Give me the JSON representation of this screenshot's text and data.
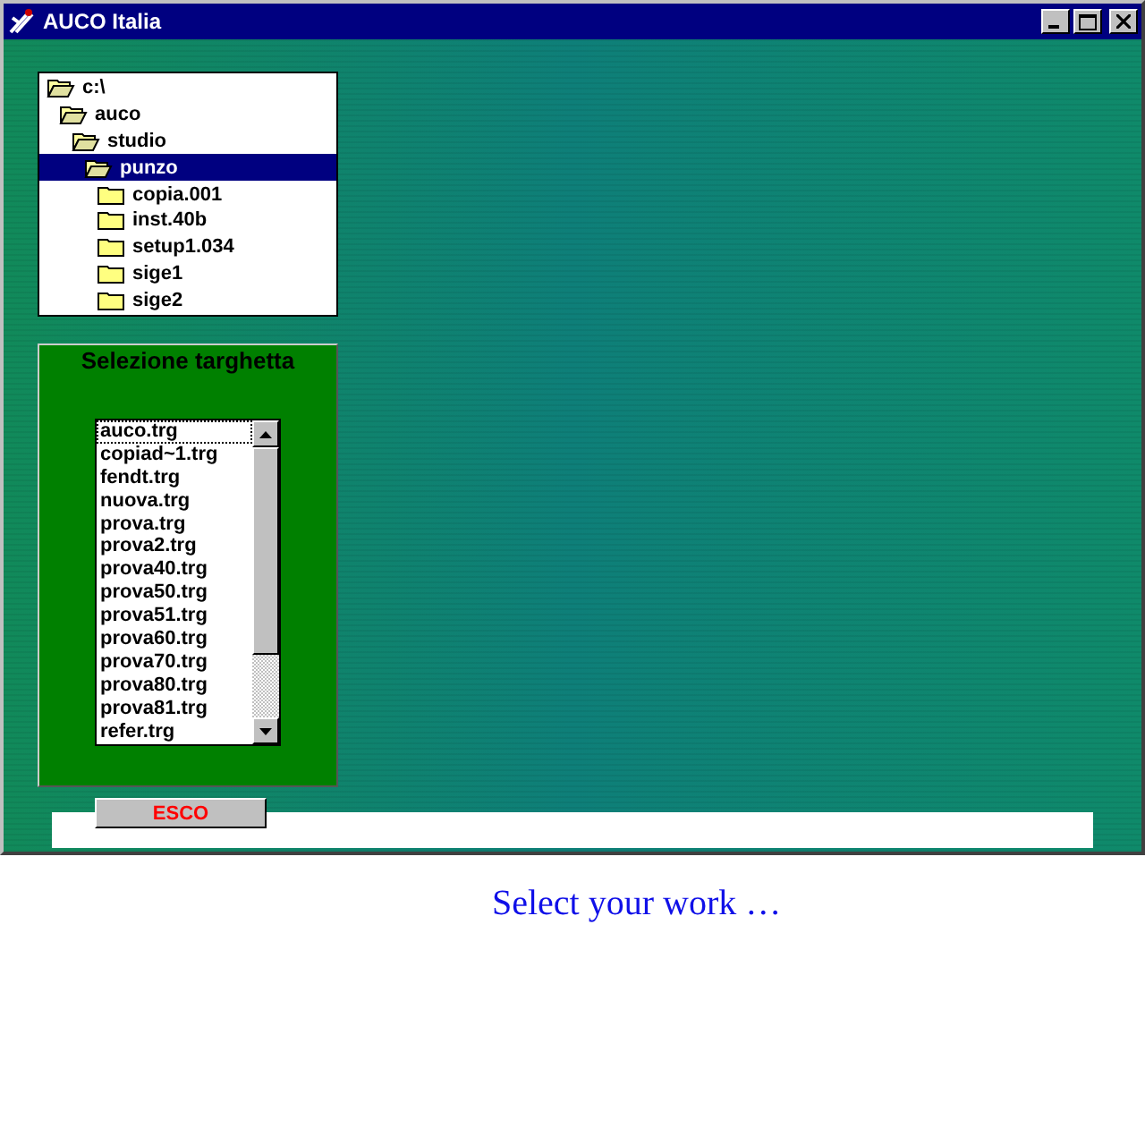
{
  "window": {
    "title": "AUCO Italia"
  },
  "folder_tree": [
    {
      "label": "c:\\",
      "expanded": true,
      "selected": false,
      "children": [
        {
          "label": "auco",
          "expanded": true,
          "selected": false,
          "children": [
            {
              "label": "studio",
              "expanded": true,
              "selected": false,
              "children": [
                {
                  "label": "punzo",
                  "expanded": true,
                  "selected": true,
                  "children": [
                    {
                      "label": "copia.001",
                      "expanded": false,
                      "selected": false
                    },
                    {
                      "label": "inst.40b",
                      "expanded": false,
                      "selected": false
                    },
                    {
                      "label": "setup1.034",
                      "expanded": false,
                      "selected": false
                    },
                    {
                      "label": "sige1",
                      "expanded": false,
                      "selected": false
                    },
                    {
                      "label": "sige2",
                      "expanded": false,
                      "selected": false
                    }
                  ]
                }
              ]
            }
          ]
        }
      ]
    }
  ],
  "target_panel": {
    "title": "Selezione targhetta",
    "files": [
      {
        "label": "auco.trg",
        "focused": true
      },
      {
        "label": "copiad~1.trg",
        "focused": false
      },
      {
        "label": "fendt.trg",
        "focused": false
      },
      {
        "label": "nuova.trg",
        "focused": false
      },
      {
        "label": "prova.trg",
        "focused": false
      },
      {
        "label": "prova2.trg",
        "focused": false
      },
      {
        "label": "prova40.trg",
        "focused": false
      },
      {
        "label": "prova50.trg",
        "focused": false
      },
      {
        "label": "prova51.trg",
        "focused": false
      },
      {
        "label": "prova60.trg",
        "focused": false
      },
      {
        "label": "prova70.trg",
        "focused": false
      },
      {
        "label": "prova80.trg",
        "focused": false
      },
      {
        "label": "prova81.trg",
        "focused": false
      },
      {
        "label": "refer.trg",
        "focused": false
      }
    ]
  },
  "exit_button": "ESCO",
  "message": "Select your work …"
}
